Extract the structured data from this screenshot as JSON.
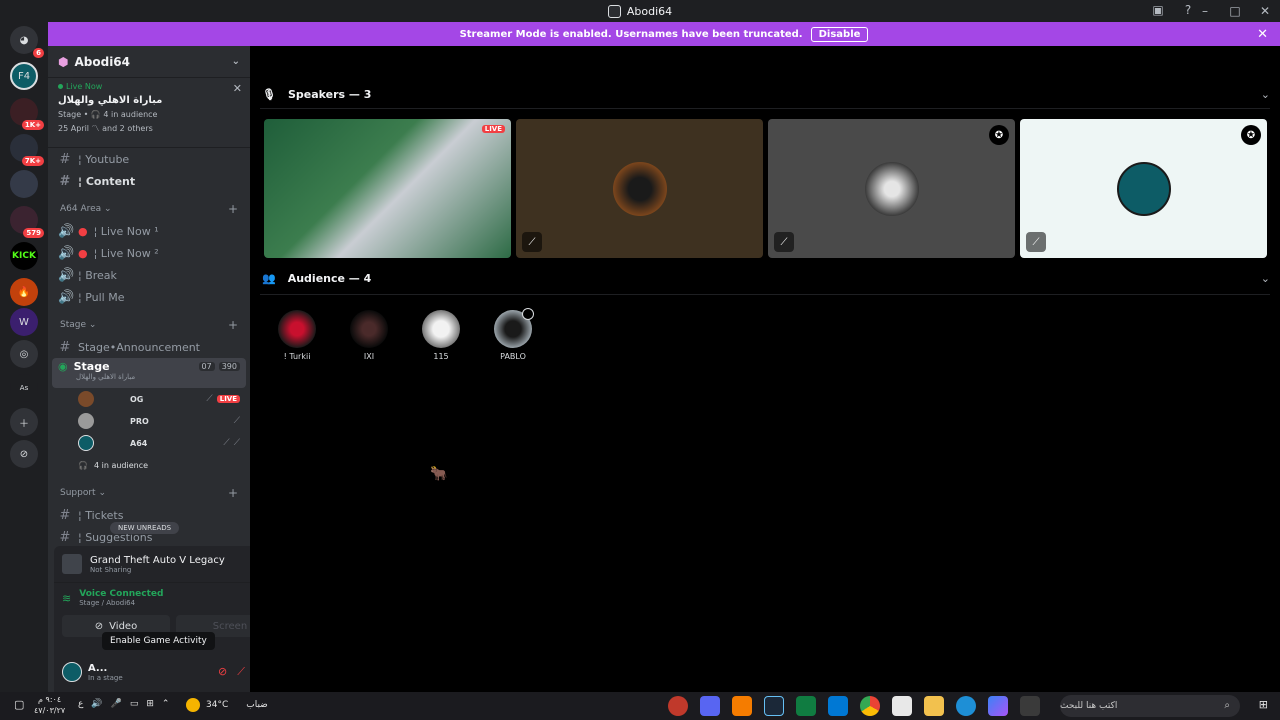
{
  "window": {
    "title": "Abodi64"
  },
  "banner": {
    "text": "Streamer Mode is enabled. Usernames have been truncated.",
    "button": "Disable"
  },
  "rail": {
    "servers": [
      {
        "label": "discord-home",
        "badge": "6"
      },
      {
        "label": "A64",
        "badge": ""
      },
      {
        "label": "folder-1",
        "badge": "1K+"
      },
      {
        "label": "folder-2",
        "badge": "7K+"
      },
      {
        "label": "folder-3",
        "badge": ""
      },
      {
        "label": "folder-4",
        "badge": "579"
      },
      {
        "label": "KICK",
        "badge": ""
      },
      {
        "label": "fire",
        "badge": ""
      },
      {
        "label": "W",
        "badge": ""
      },
      {
        "label": "ring",
        "badge": ""
      },
      {
        "label": "As",
        "badge": ""
      }
    ]
  },
  "sidebar": {
    "server_name": "Abodi64",
    "live_card": {
      "status": "Live Now",
      "title": "مباراة الاهلي والهلال",
      "meta": "Stage • 🎧 4 in audience",
      "meta2": "25 April 〽 and 2 others"
    },
    "top_channels": [
      {
        "name": "¦ Youtube",
        "bold": false
      },
      {
        "name": "¦ Content",
        "bold": true
      }
    ],
    "categories": [
      {
        "name": "A64 Area",
        "channels": [
          {
            "name": "¦ Live Now ¹"
          },
          {
            "name": "¦ Live Now ²"
          },
          {
            "name": "¦ Break"
          },
          {
            "name": "¦ Pull Me"
          }
        ]
      }
    ],
    "stage_category": "Stage",
    "stage_announce": "Stage•Announcement",
    "stage": {
      "name": "Stage",
      "sub": "مباراة الاهلي والهلال",
      "count_a": "07",
      "count_b": "390"
    },
    "members": [
      {
        "tag": "OG",
        "live": "LIVE"
      },
      {
        "tag": "PRO",
        "live": ""
      },
      {
        "tag": "A64",
        "live": ""
      }
    ],
    "audience_count": "4 in audience",
    "support_category": "Support",
    "support_channels": [
      {
        "name": "¦ Tickets"
      },
      {
        "name": "¦ Suggestions"
      }
    ],
    "new_unreads": "NEW UNREADS"
  },
  "game_panel": {
    "title": "Grand Theft Auto V Legacy",
    "sub": "Not Sharing"
  },
  "voice_panel": {
    "status": "Voice Connected",
    "location": "Stage / Abodi64",
    "video_label": "Video",
    "screen_label": "Screen"
  },
  "user_panel": {
    "name": "A...",
    "status": "In a stage"
  },
  "tooltip": "Enable Game Activity",
  "main": {
    "speakers_header": "Speakers — 3",
    "audience_header": "Audience — 4",
    "live_tag": "LIVE",
    "audience": [
      {
        "name": "! Turkii"
      },
      {
        "name": "IXI"
      },
      {
        "name": "115"
      },
      {
        "name": "PABLO"
      }
    ]
  },
  "taskbar": {
    "search_placeholder": "اكتب هنا للبحث",
    "weather_temp": "34°C",
    "weather_desc": "ضباب",
    "clock_time": "٩:٠٤ م",
    "clock_date": "٤٧/٠٣/٢٧"
  }
}
